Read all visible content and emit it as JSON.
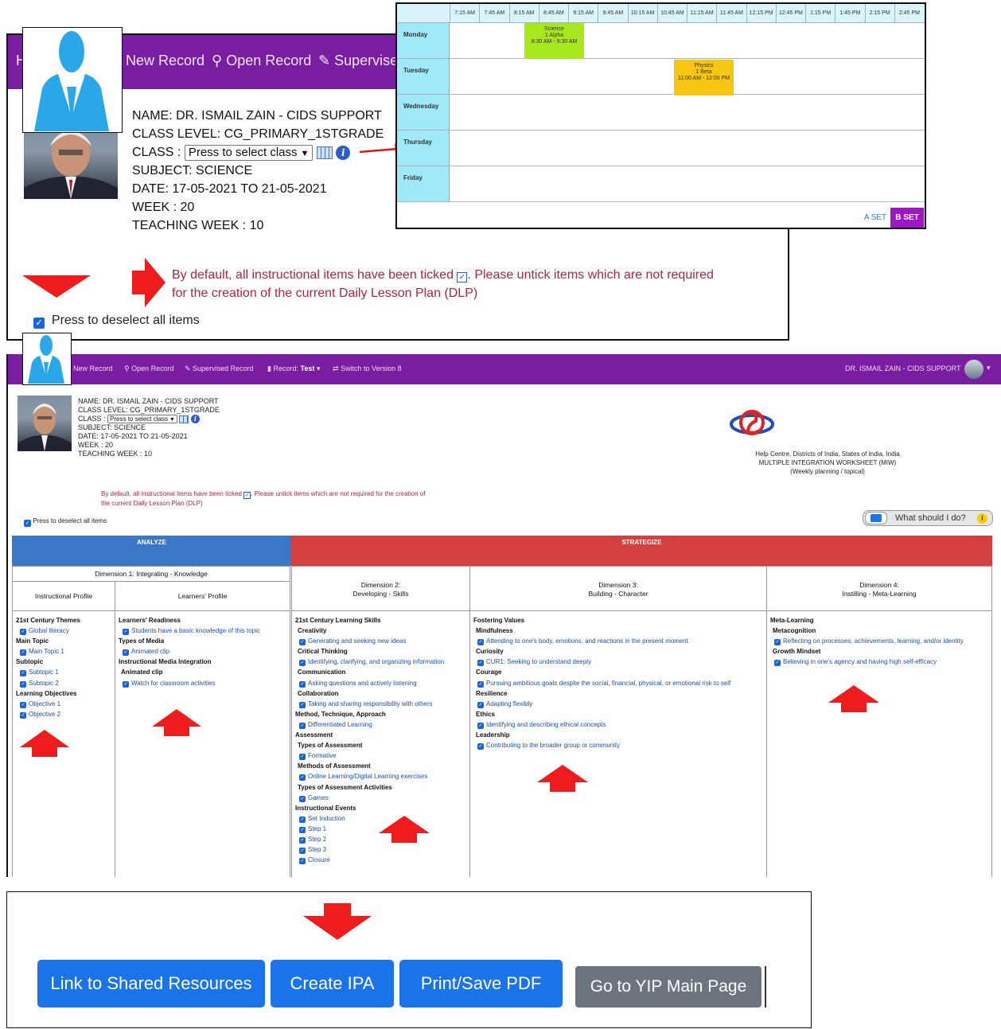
{
  "zoom_header": {
    "nav": {
      "home_fragment": "H",
      "new_record": "New Record",
      "open_record": "Open Record",
      "supervised_fragment": "Supervisec"
    },
    "name_line": "NAME: DR. ISMAIL ZAIN - CIDS SUPPORT",
    "class_level_line": "CLASS LEVEL: CG_PRIMARY_1STGRADE",
    "class_label": "CLASS :",
    "class_select": "Press to select class",
    "subject_line": "SUBJECT: SCIENCE",
    "date_line": "DATE: 17-05-2021 TO 21-05-2021",
    "week_line": "WEEK : 20",
    "teaching_week_line": "TEACHING WEEK : 10",
    "notice_before": "By default, all instructional items have been ticked",
    "notice_after": ". Please untick items which are not required for the creation of the current Daily Lesson Plan (DLP)",
    "deselect_label": "Press to deselect all items"
  },
  "timetable": {
    "times": [
      "7:15 AM",
      "7:45 AM",
      "8:15 AM",
      "8:45 AM",
      "9:15 AM",
      "9:45 AM",
      "10:15 AM",
      "10:45 AM",
      "11:15 AM",
      "11:45 AM",
      "12:15 PM",
      "12:45 PM",
      "1:15 PM",
      "1:45 PM",
      "2:15 PM",
      "2:45 PM"
    ],
    "days": [
      "Monday",
      "Tuesday",
      "Wednesday",
      "Thursday",
      "Friday"
    ],
    "events": [
      {
        "subject": "Science",
        "class": "1 Alpha",
        "time": "8:30 AM - 9:30 AM",
        "color": "#a8e61d"
      },
      {
        "subject": "Physics",
        "class": "1 Beta",
        "time": "11:00 AM - 12:00 PM",
        "color": "#f7c613"
      }
    ],
    "a_set": "A SET",
    "b_set": "B SET"
  },
  "main": {
    "nav": {
      "new_record": "New Record",
      "open_record": "Open Record",
      "supervised_record": "Supervised Record",
      "record_label": "Record:",
      "record_value": "Test",
      "switch_version": "Switch to Version 8",
      "user": "DR. ISMAIL ZAIN - CIDS SUPPORT"
    },
    "org_line1": "Help Centre, Districts of India, States of India, India",
    "org_line2": "MULTIPLE INTEGRATION WORKSHEET (MIW)",
    "org_line3": "(Weekly planning / topical)",
    "help_button": "What should I do?",
    "analyze": "ANALYZE",
    "strategize": "STRATEGIZE",
    "dim1_title": "Dimension 1: Integrating - Knowledge",
    "instructional_profile": "Instructional Profile",
    "learners_profile": "Learners' Profile",
    "dim2_line1": "Dimension 2:",
    "dim2_line2": "Developing - Skills",
    "dim3_line1": "Dimension 3:",
    "dim3_line2": "Building - Character",
    "dim4_line1": "Dimension 4:",
    "dim4_line2": "Instilling - Meta-Learning",
    "col_instructional": [
      {
        "t": "h",
        "v": "21st Century Themes"
      },
      {
        "t": "l",
        "v": "Global literacy"
      },
      {
        "t": "h",
        "v": "Main Topic"
      },
      {
        "t": "l",
        "v": "Main Topic 1"
      },
      {
        "t": "h",
        "v": "Subtopic"
      },
      {
        "t": "l",
        "v": "Subtopic 1"
      },
      {
        "t": "l",
        "v": "Subtopic 2"
      },
      {
        "t": "h",
        "v": "Learning Objectives"
      },
      {
        "t": "l",
        "v": "Objective 1"
      },
      {
        "t": "l",
        "v": "Objective 2"
      }
    ],
    "col_learners": [
      {
        "t": "h",
        "v": "Learners' Readiness"
      },
      {
        "t": "l",
        "v": "Students have a basic knowledge of this topic"
      },
      {
        "t": "h",
        "v": "Types of Media"
      },
      {
        "t": "l",
        "v": "Animated clip"
      },
      {
        "t": "h",
        "v": "Instructional Media Integration"
      },
      {
        "t": "h2",
        "v": "Animated clip"
      },
      {
        "t": "l",
        "v": "Watch for classroom activities"
      }
    ],
    "col_skills": [
      {
        "t": "h",
        "v": "21st Century Learning Skills"
      },
      {
        "t": "h2",
        "v": "Creativity"
      },
      {
        "t": "l",
        "v": "Generating and seeking new ideas"
      },
      {
        "t": "h2",
        "v": "Critical Thinking"
      },
      {
        "t": "l",
        "v": "Identifying, clarifying, and organizing information"
      },
      {
        "t": "h2",
        "v": "Communication"
      },
      {
        "t": "l",
        "v": "Asking questions and actively listening"
      },
      {
        "t": "h2",
        "v": "Collaboration"
      },
      {
        "t": "l",
        "v": "Taking and sharing responsibility with others"
      },
      {
        "t": "h",
        "v": "Method, Technique, Approach"
      },
      {
        "t": "l",
        "v": "Differentiated Learning"
      },
      {
        "t": "h",
        "v": "Assessment"
      },
      {
        "t": "h2",
        "v": "Types of Assessment"
      },
      {
        "t": "l",
        "v": "Formative"
      },
      {
        "t": "h2",
        "v": "Methods of Assessment"
      },
      {
        "t": "l",
        "v": "Online Learning/Digital Learning exercises"
      },
      {
        "t": "h2",
        "v": "Types of Assessment Activities"
      },
      {
        "t": "l",
        "v": "Games"
      },
      {
        "t": "h",
        "v": "Instructional Events"
      },
      {
        "t": "l",
        "v": "Set Induction"
      },
      {
        "t": "l",
        "v": "Step 1"
      },
      {
        "t": "l",
        "v": "Step 2"
      },
      {
        "t": "l",
        "v": "Step 3"
      },
      {
        "t": "l",
        "v": "Closure"
      }
    ],
    "col_character": [
      {
        "t": "h",
        "v": "Fostering Values"
      },
      {
        "t": "h2",
        "v": "Mindfulness"
      },
      {
        "t": "l",
        "v": "Attending to one's body, emotions, and reactions in the present moment"
      },
      {
        "t": "h2",
        "v": "Curiosity"
      },
      {
        "t": "l",
        "v": "CUR1: Seeking to understand deeply"
      },
      {
        "t": "h2",
        "v": "Courage"
      },
      {
        "t": "l",
        "v": "Pursuing ambitious goals despite the social, financial, physical, or emotional risk to self"
      },
      {
        "t": "h2",
        "v": "Resilience"
      },
      {
        "t": "l",
        "v": "Adapting flexibly"
      },
      {
        "t": "h2",
        "v": "Ethics"
      },
      {
        "t": "l",
        "v": "Identifying and describing ethical concepts"
      },
      {
        "t": "h2",
        "v": "Leadership"
      },
      {
        "t": "l",
        "v": "Contributing to the broader group or community"
      }
    ],
    "col_meta": [
      {
        "t": "h",
        "v": "Meta-Learning"
      },
      {
        "t": "h2",
        "v": "Metacognition"
      },
      {
        "t": "l",
        "v": "Reflecting on processes, achievements, learning, and/or identity"
      },
      {
        "t": "h2",
        "v": "Growth Mindset"
      },
      {
        "t": "l",
        "v": "Believing in one's agency and having high self-efficacy"
      }
    ]
  },
  "buttons": {
    "shared_resources": "Link to Shared Resources",
    "create_ipa": "Create IPA",
    "print_pdf": "Print/Save PDF",
    "yip_main": "Go to YIP Main Page"
  },
  "colors": {
    "nav_purple": "#7a1ea1",
    "analyze_blue": "#3a78c7",
    "strategize_red": "#d63f3f",
    "button_blue": "#1a73e8",
    "button_gray": "#6c757d",
    "arrow_red": "#ee1c1c"
  }
}
